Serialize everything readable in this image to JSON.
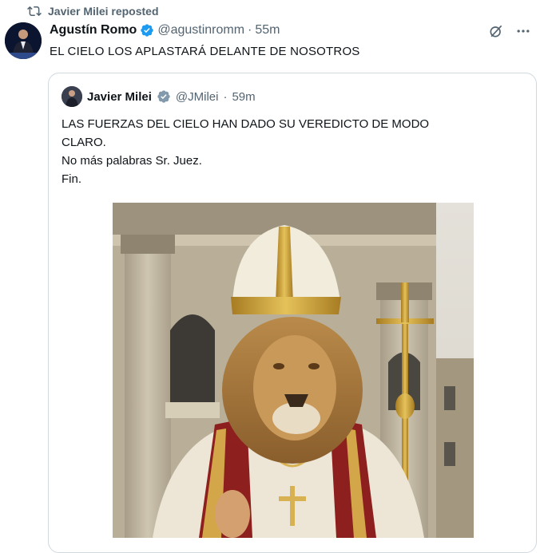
{
  "repost": {
    "label": "Javier Milei reposted",
    "icon": "repost-icon"
  },
  "tweet": {
    "author_name": "Agustín Romo",
    "handle": "@agustinromm",
    "separator": "·",
    "time": "55m",
    "text": "EL CIELO LOS APLASTARÁ DELANTE DE NOSOTROS",
    "icons": [
      "verified-badge-icon",
      "grok-icon",
      "more-icon"
    ]
  },
  "quote": {
    "author_name": "Javier Milei",
    "handle": "@JMilei",
    "separator": "·",
    "time": "59m",
    "lines": [
      "LAS FUERZAS DEL CIELO HAN DADO SU VEREDICTO DE MODO",
      "CLARO.",
      "No más palabras Sr. Juez.",
      "Fin."
    ],
    "verified_badge_color": "#829aab"
  },
  "colors": {
    "accent": "#1d9bf0",
    "muted": "#536471",
    "text": "#0f1419",
    "border": "#cfd9de"
  }
}
